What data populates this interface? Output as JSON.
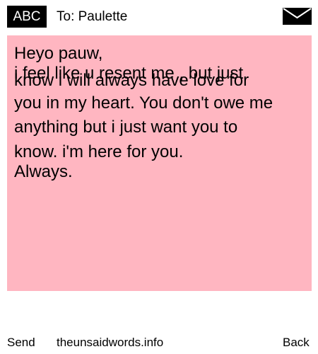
{
  "header": {
    "abc_label": "ABC",
    "to_label": "To: Paulette",
    "envelope_icon": "envelope-icon"
  },
  "message": {
    "background_color": "#ffb6c1",
    "lines": [
      "Heyo pauw,",
      "i feel like u resent me , but just",
      "know i will always have love for",
      "you in my heart. You don't owe me",
      "anything but i just want you to",
      "know. i'm here for you.",
      "Always."
    ]
  },
  "footer": {
    "send_label": "Send",
    "site_label": "theunsaidwords.info",
    "back_label": "Back"
  }
}
